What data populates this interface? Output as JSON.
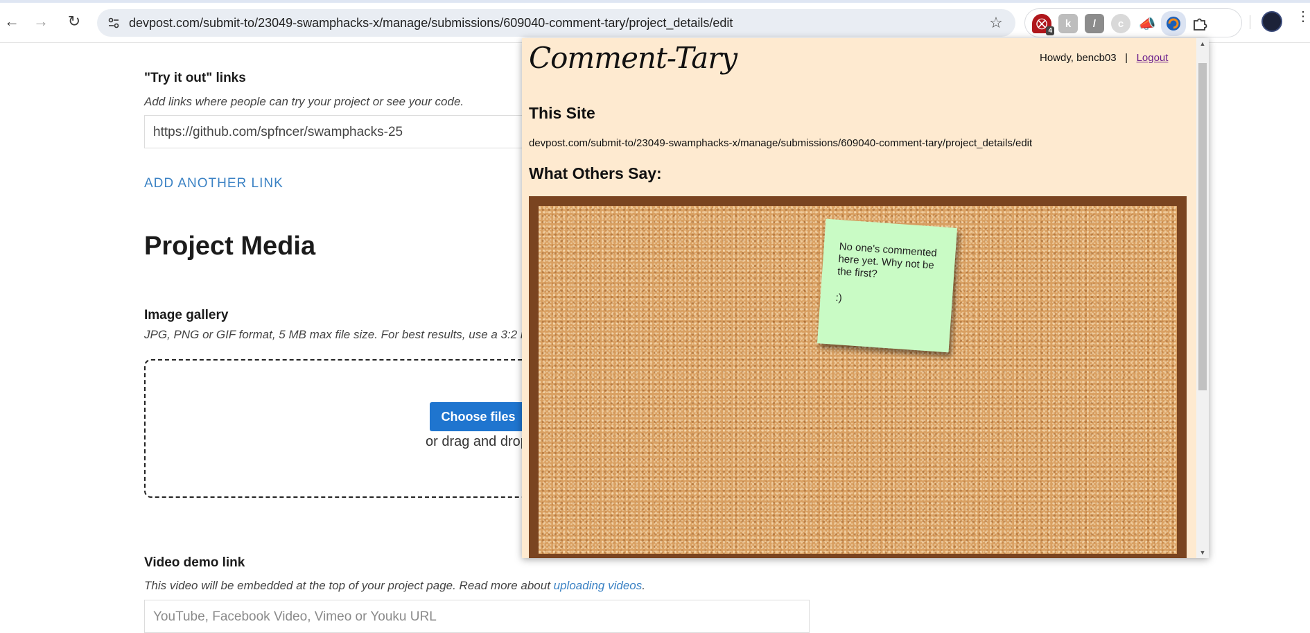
{
  "browser": {
    "url": "devpost.com/submit-to/23049-swamphacks-x/manage/submissions/609040-comment-tary/project_details/edit",
    "extensions": [
      {
        "name": "shield-extension-icon",
        "color": "#b0161b",
        "badge": "4"
      },
      {
        "name": "k-extension-icon",
        "color": "#9e9e9e",
        "badge": ""
      },
      {
        "name": "slash-extension-icon",
        "color": "#8c8c8c",
        "badge": ""
      },
      {
        "name": "circle-extension-icon",
        "color": "#cfcfcf",
        "badge": ""
      },
      {
        "name": "megaphone-extension-icon",
        "color": "#e8551b",
        "badge": ""
      },
      {
        "name": "comment-tary-extension-icon",
        "color": "#e8731b",
        "badge": ""
      },
      {
        "name": "puzzle-extensions-icon",
        "color": "#444444",
        "badge": ""
      }
    ]
  },
  "page": {
    "try_links_label": "\"Try it out\" links",
    "try_links_hint": "Add links where people can try your project or see your code.",
    "try_links_value": "https://github.com/spfncer/swamphacks-25",
    "add_link_label": "ADD ANOTHER LINK",
    "media_heading": "Project Media",
    "gallery_label": "Image gallery",
    "gallery_hint": "JPG, PNG or GIF format, 5 MB max file size. For best results, use a 3:2 r",
    "choose_files_label": "Choose files",
    "drag_text": "or drag and drop",
    "video_label": "Video demo link",
    "video_hint_pre": "This video will be embedded at the top of your project page. Read more about ",
    "video_hint_link": "uploading videos",
    "video_hint_post": ".",
    "video_placeholder": "YouTube, Facebook Video, Vimeo or Youku URL"
  },
  "popup": {
    "logo": "Comment-Tary",
    "greeting": "Howdy, bencb03",
    "divider": "|",
    "logout_label": "Logout",
    "this_site_heading": "This Site",
    "site_url": "devpost.com/submit-to/23049-swamphacks-x/manage/submissions/609040-comment-tary/project_details/edit",
    "others_heading": "What Others Say:",
    "note_text": "No one's commented here yet. Why not be the first?",
    "note_smile": ":)"
  }
}
